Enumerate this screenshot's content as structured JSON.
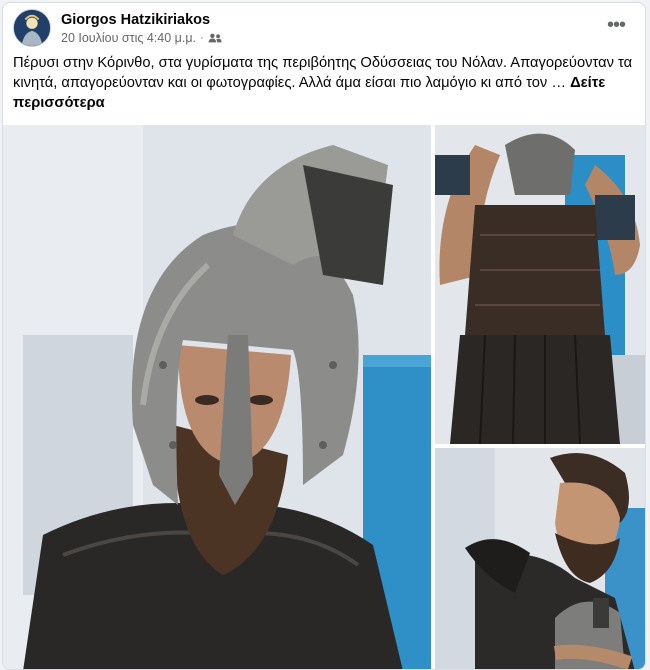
{
  "post": {
    "author": "Giorgos Hatzikiriakos",
    "timestamp": "20 Ιουλίου στις 4:40 μ.μ.",
    "separator": "·",
    "audience_icon": "friends-icon",
    "more_icon": "more-options-icon",
    "more_label": "•••",
    "text": "Πέρυσι στην Κόρινθο, στα γυρίσματα της περιβόητης Οδύσσειας του Νόλαν. Απαγορεύονταν τα κινητά, απαγορεύονταν και οι φωτογραφίες. Αλλά άμα είσαι πιο λαμόγιο κι από τον … ",
    "see_more_label": "Δείτε περισσότερα"
  },
  "colors": {
    "name": "#050505",
    "meta": "#65676b",
    "card_bg": "#ffffff",
    "page_bg": "#f0f2f5"
  }
}
